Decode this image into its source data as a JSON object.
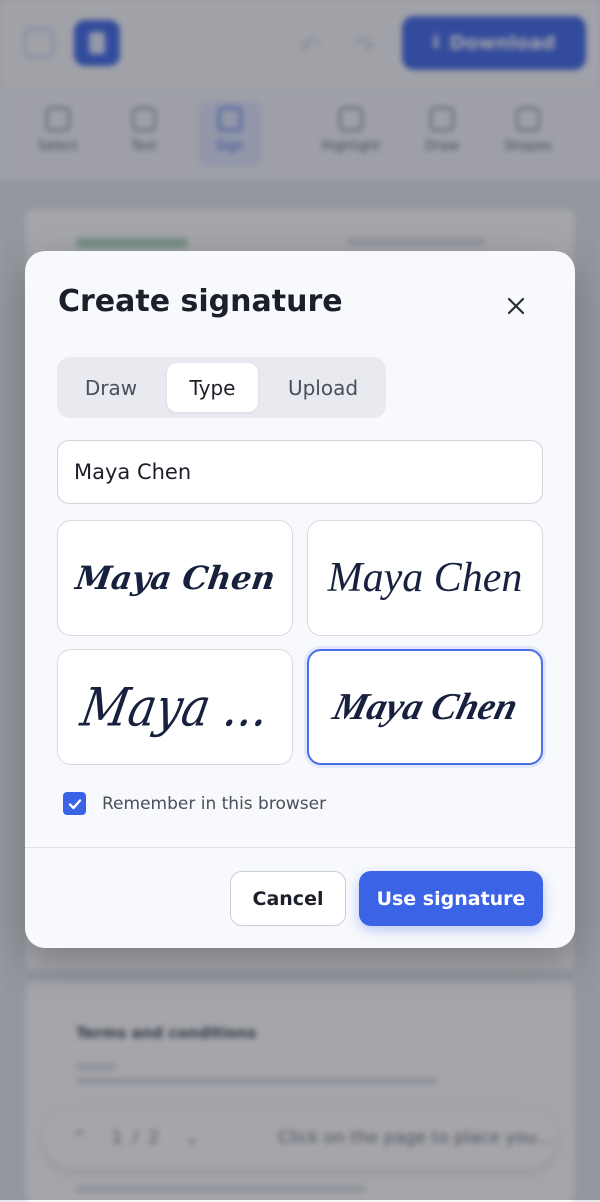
{
  "colors": {
    "accent": "#3b63e6",
    "title_text": "#1c1f2a",
    "signature_ink": "#17213d",
    "modal_bg": "#f8f9fc"
  },
  "background": {
    "download_label": "Download",
    "toolbar": [
      "Select",
      "Text",
      "Sign",
      "Highlight",
      "Draw",
      "Shapes"
    ],
    "active_tool": "Sign",
    "doc_section_title": "Terms and conditions",
    "pager": {
      "current": "1",
      "separator": "/",
      "total": "2"
    },
    "hint": "Click on the page to place you..."
  },
  "modal": {
    "title": "Create signature",
    "tabs": [
      {
        "label": "Draw",
        "selected": false
      },
      {
        "label": "Type",
        "selected": true
      },
      {
        "label": "Upload",
        "selected": false
      }
    ],
    "name_value": "Maya Chen",
    "styles": [
      {
        "preview": "Maya Chen",
        "selected": false
      },
      {
        "preview": "Maya Chen",
        "selected": false
      },
      {
        "preview": "Maya ...",
        "selected": false
      },
      {
        "preview": "Maya Chen",
        "selected": true
      }
    ],
    "remember": {
      "label": "Remember in this browser",
      "checked": true
    },
    "cancel_label": "Cancel",
    "confirm_label": "Use signature"
  }
}
